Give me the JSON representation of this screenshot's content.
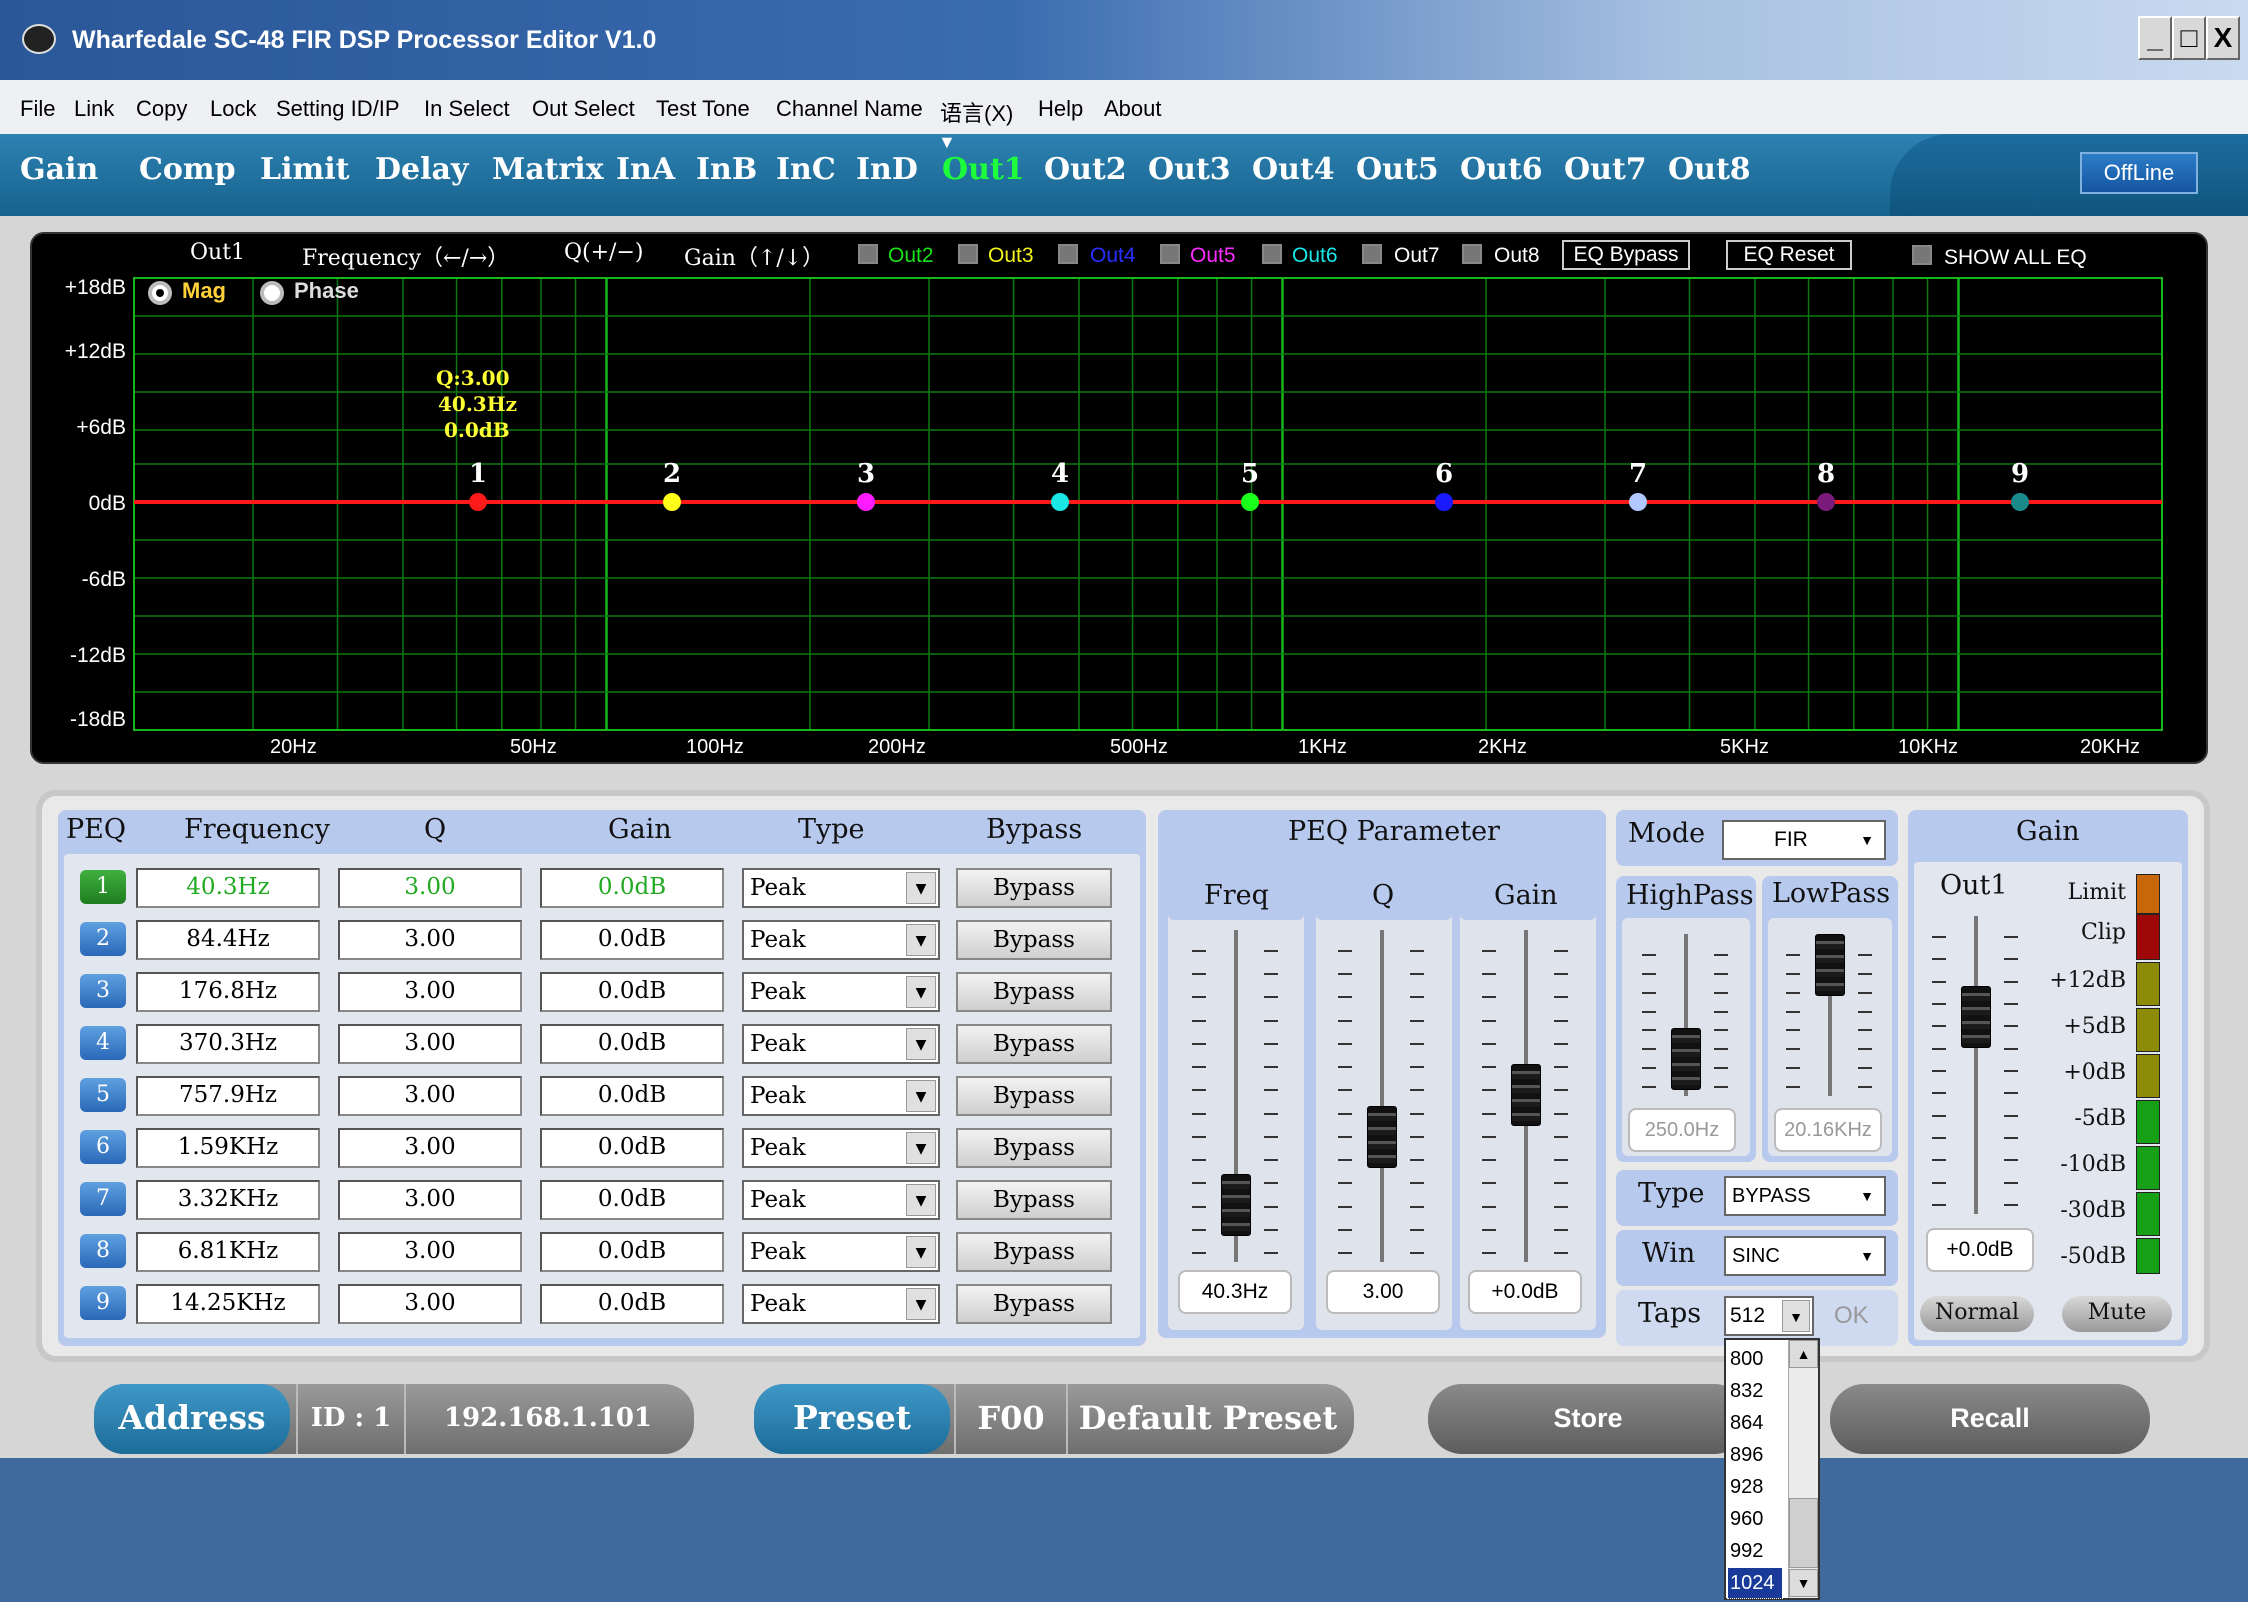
{
  "window": {
    "title": "Wharfedale SC-48 FIR DSP Processor Editor V1.0",
    "min": "_",
    "max": "□",
    "close": "X"
  },
  "menu": [
    "File",
    "Link",
    "Copy",
    "Lock",
    "Setting ID/IP",
    "In Select",
    "Out Select",
    "Test Tone",
    "Channel Name",
    "语言(X)",
    "Help",
    "About"
  ],
  "tabs": [
    "Gain",
    "Comp",
    "Limit",
    "Delay",
    "Matrix",
    "InA",
    "InB",
    "InC",
    "InD",
    "Out1",
    "Out2",
    "Out3",
    "Out4",
    "Out5",
    "Out6",
    "Out7",
    "Out8"
  ],
  "active_tab": "Out1",
  "status": "OffLine",
  "graph": {
    "channel": "Out1",
    "freq_hint": "Frequency（←/→）",
    "q_hint": "Q(+/−)",
    "gain_hint": "Gain（↑/↓）",
    "channels": [
      {
        "label": "Out2",
        "color": "#17e317"
      },
      {
        "label": "Out3",
        "color": "#f3f31a"
      },
      {
        "label": "Out4",
        "color": "#2830ff"
      },
      {
        "label": "Out5",
        "color": "#ff2bff"
      },
      {
        "label": "Out6",
        "color": "#19e6e6"
      },
      {
        "label": "Out7",
        "color": "#ffffff"
      },
      {
        "label": "Out8",
        "color": "#ffffff"
      }
    ],
    "eq_bypass": "EQ Bypass",
    "eq_reset": "EQ Reset",
    "show_all": "SHOW ALL EQ",
    "mag": "Mag",
    "phase": "Phase",
    "tooltip": {
      "q": "Q:3.00",
      "freq": "40.3Hz",
      "gain": "0.0dB"
    },
    "ylabels": [
      "+18dB",
      "+12dB",
      "+6dB",
      "0dB",
      "-6dB",
      "-12dB",
      "-18dB"
    ],
    "xlabels": [
      "20Hz",
      "50Hz",
      "100Hz",
      "200Hz",
      "500Hz",
      "1KHz",
      "2KHz",
      "5KHz",
      "10KHz",
      "20KHz"
    ],
    "point_labels": [
      "1",
      "2",
      "3",
      "4",
      "5",
      "6",
      "7",
      "8",
      "9"
    ],
    "point_colors": [
      "#ff1a1a",
      "#ffff1a",
      "#ff1aff",
      "#1ae6e6",
      "#1aff1a",
      "#1a1aff",
      "#b0c8ff",
      "#7a1a7a",
      "#1a8a8a"
    ]
  },
  "peq": {
    "headers": {
      "peq": "PEQ",
      "freq": "Frequency",
      "q": "Q",
      "gain": "Gain",
      "type": "Type",
      "bypass": "Bypass"
    },
    "rows": [
      {
        "n": "1",
        "freq": "40.3Hz",
        "q": "3.00",
        "gain": "0.0dB",
        "type": "Peak",
        "bypass": "Bypass"
      },
      {
        "n": "2",
        "freq": "84.4Hz",
        "q": "3.00",
        "gain": "0.0dB",
        "type": "Peak",
        "bypass": "Bypass"
      },
      {
        "n": "3",
        "freq": "176.8Hz",
        "q": "3.00",
        "gain": "0.0dB",
        "type": "Peak",
        "bypass": "Bypass"
      },
      {
        "n": "4",
        "freq": "370.3Hz",
        "q": "3.00",
        "gain": "0.0dB",
        "type": "Peak",
        "bypass": "Bypass"
      },
      {
        "n": "5",
        "freq": "757.9Hz",
        "q": "3.00",
        "gain": "0.0dB",
        "type": "Peak",
        "bypass": "Bypass"
      },
      {
        "n": "6",
        "freq": "1.59KHz",
        "q": "3.00",
        "gain": "0.0dB",
        "type": "Peak",
        "bypass": "Bypass"
      },
      {
        "n": "7",
        "freq": "3.32KHz",
        "q": "3.00",
        "gain": "0.0dB",
        "type": "Peak",
        "bypass": "Bypass"
      },
      {
        "n": "8",
        "freq": "6.81KHz",
        "q": "3.00",
        "gain": "0.0dB",
        "type": "Peak",
        "bypass": "Bypass"
      },
      {
        "n": "9",
        "freq": "14.25KHz",
        "q": "3.00",
        "gain": "0.0dB",
        "type": "Peak",
        "bypass": "Bypass"
      }
    ]
  },
  "peq_param": {
    "title": "PEQ Parameter",
    "freq_label": "Freq",
    "q_label": "Q",
    "gain_label": "Gain",
    "freq_value": "40.3Hz",
    "q_value": "3.00",
    "gain_value": "+0.0dB"
  },
  "mode": {
    "label": "Mode",
    "value": "FIR"
  },
  "filters": {
    "highpass": "HighPass",
    "lowpass": "LowPass",
    "hp_value": "250.0Hz",
    "lp_value": "20.16KHz"
  },
  "type": {
    "label": "Type",
    "value": "BYPASS"
  },
  "win": {
    "label": "Win",
    "value": "SINC"
  },
  "taps": {
    "label": "Taps",
    "value": "512",
    "ok": "OK",
    "options": [
      "800",
      "832",
      "864",
      "896",
      "928",
      "960",
      "992",
      "1024"
    ],
    "selected": "1024"
  },
  "gain_panel": {
    "title": "Gain",
    "channel": "Out1",
    "value": "+0.0dB",
    "normal": "Normal",
    "mute": "Mute",
    "meter_labels": [
      "Limit",
      "Clip",
      "+12dB",
      "+5dB",
      "+0dB",
      "-5dB",
      "-10dB",
      "-30dB",
      "-50dB"
    ]
  },
  "bottom": {
    "address": "Address",
    "id": "ID : 1",
    "ip": "192.168.1.101",
    "preset": "Preset",
    "preset_code": "F00",
    "preset_name": "Default Preset",
    "store": "Store",
    "recall": "Recall"
  }
}
